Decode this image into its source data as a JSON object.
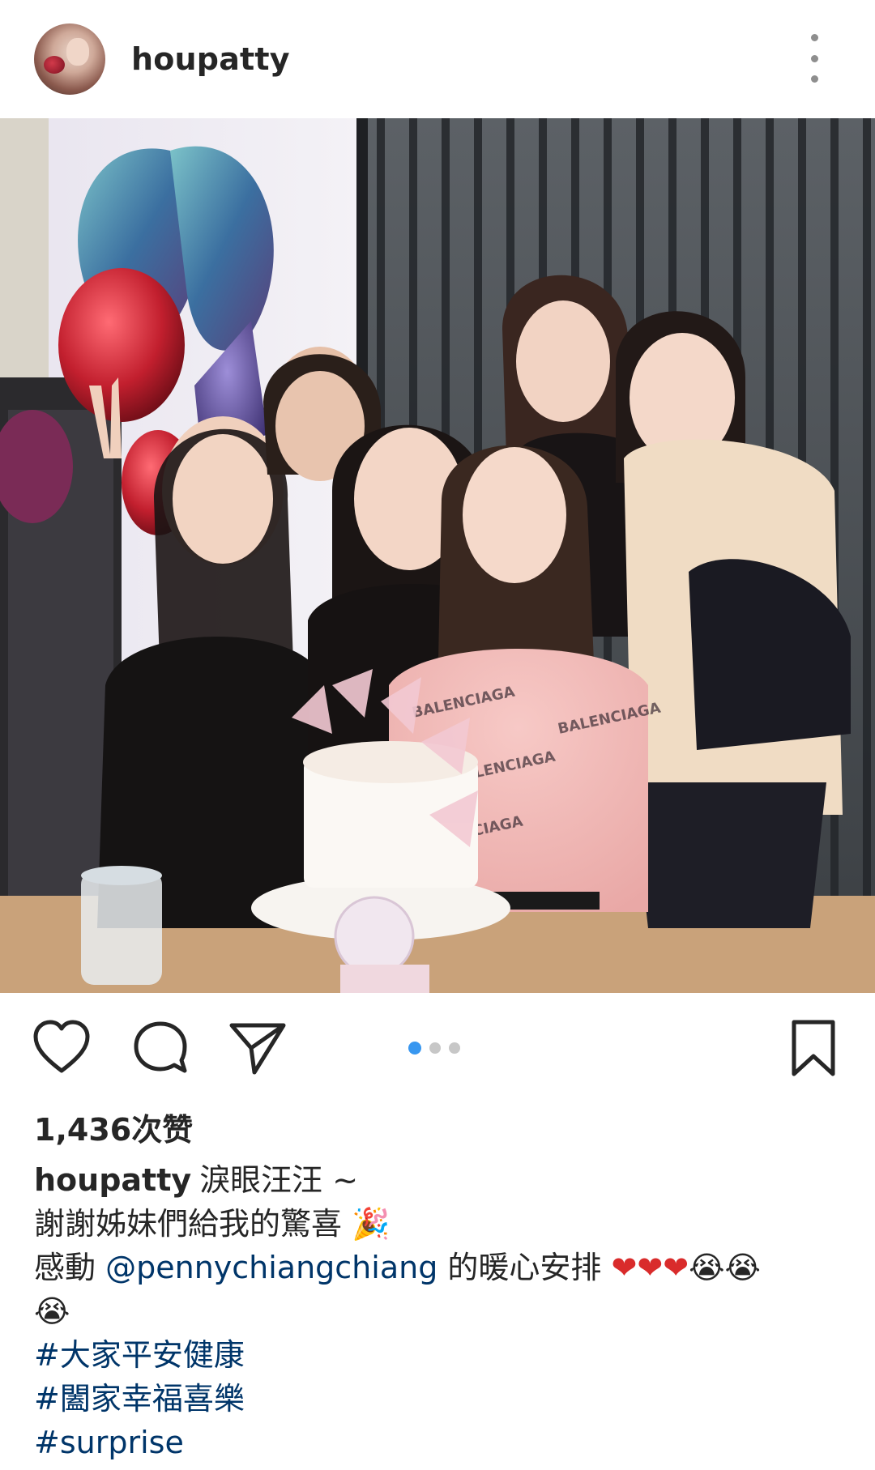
{
  "header": {
    "username": "houpatty",
    "avatar": "avatar",
    "more_icon": "more-options-icon"
  },
  "photo": {
    "description_icon": "photo"
  },
  "actions": {
    "like_icon": "heart-icon",
    "comment_icon": "comment-icon",
    "share_icon": "send-icon",
    "bookmark_icon": "bookmark-icon",
    "carousel": {
      "total": 3,
      "active": 1
    }
  },
  "likes": {
    "text": "1,436次赞"
  },
  "caption": {
    "username": "houpatty",
    "line1_text": "淚眼汪汪 ~",
    "line2_text": "謝謝姊妹們給我的驚喜",
    "line2_emoji": "🎉",
    "line3_prefix": "感動",
    "mention": "@pennychiangchiang",
    "line3_suffix": "的暖心安排",
    "hearts": "❤❤❤",
    "crying": "😭😭",
    "line4_crying": "😭",
    "hashtags": [
      "#大家平安健康",
      "#闔家幸福喜樂",
      "#surprise"
    ]
  },
  "colors": {
    "link": "#003569",
    "accent_dot": "#3897f0",
    "text": "#262626"
  }
}
